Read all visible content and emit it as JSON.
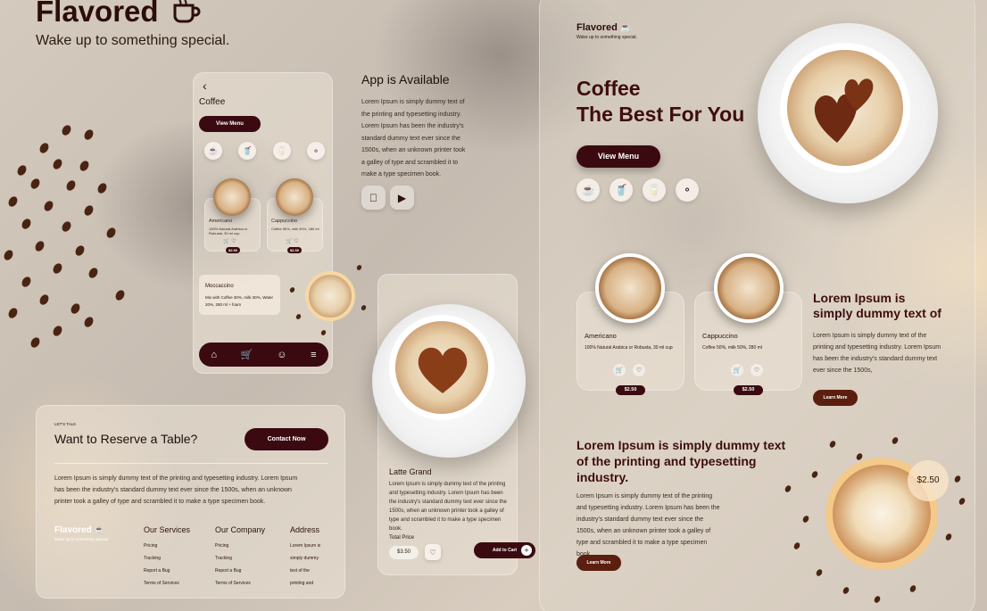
{
  "brand": {
    "name": "Flavored",
    "tagline": "Wake up to something special.",
    "icon": "coffee-cup-icon"
  },
  "phone": {
    "back": "‹",
    "title": "Coffee",
    "view_menu": "View Menu",
    "products": [
      {
        "name": "Americano",
        "desc": "100% Natural Arabica or Robusta, 30 ml cup",
        "price": "$2.50"
      },
      {
        "name": "Cappuccino",
        "desc": "Coffee 50%, milk 50%, 280 ml",
        "price": "$2.50"
      }
    ],
    "moccaccino": {
      "name": "Moccaccino",
      "desc": "Mix with Coffee 30%, milk 30%, Water 20%, 280 ml + foam"
    }
  },
  "app": {
    "title": "App is Available",
    "body": "Lorem Ipsum is simply dummy text of the printing and typesetting industry. Lorem Ipsum has been the industry's standard dummy text ever since the 1500s, when an unknown printer took a galley of type and scrambled it to make a type specimen book."
  },
  "latte": {
    "name": "Latte Grand",
    "body": "Lorem Ipsum is simply dummy text of the printing and typesetting industry. Lorem Ipsum has been the industry's standard dummy text ever since the 1500s, when an unknown printer took a galley of type and scrambled it to make a type specimen book.",
    "price_label": "Total Price",
    "price": "$3.50",
    "add_to_cart": "Add to Cart",
    "plus": "+"
  },
  "reserve": {
    "eyebrow": "LET'S TALK",
    "title": "Want to Reserve a Table?",
    "contact": "Contact Now",
    "body": "Lorem Ipsum is simply dummy text of the printing and typesetting industry. Lorem Ipsum has been the industry's standard dummy text ever since the 1500s, when an unknown printer took a galley of type and scrambled it to make a type specimen book."
  },
  "footer": {
    "brand": "Flavored",
    "tagline": "Wake up to something special.",
    "services": {
      "title": "Our Services",
      "items": [
        "Pricing",
        "Tracking",
        "Report a Bug",
        "Terms of Services"
      ]
    },
    "company": {
      "title": "Our Company",
      "items": [
        "Pricing",
        "Tracking",
        "Report a Bug",
        "Terms of Services"
      ]
    },
    "address": {
      "title": "Address",
      "lines": [
        "Lorem Ipsum is",
        "simply dummy",
        "text of the",
        "printing and"
      ]
    }
  },
  "hero": {
    "brand": "Flavored",
    "tagline": "Wake up to something special.",
    "title1": "Coffee",
    "title2": "The Best For You",
    "view_menu": "View Menu"
  },
  "desk_products": [
    {
      "name": "Americano",
      "desc": "100% Natural Arabica or Robusta, 30 ml cup",
      "price": "$2.50"
    },
    {
      "name": "Cappuccino",
      "desc": "Coffee 50%, milk 50%, 280 ml",
      "price": "$2.50"
    }
  ],
  "section2": {
    "title": "Lorem Ipsum is simply dummy text of",
    "body": "Lorem Ipsum is simply dummy text of the printing and typesetting industry. Lorem Ipsum has been the industry's standard dummy text ever since the 1500s,",
    "learn_more": "Learn More"
  },
  "section3": {
    "title": "Lorem Ipsum is simply dummy text of the printing and typesetting industry.",
    "body": "Lorem Ipsum is simply dummy text of the printing and typesetting industry. Lorem Ipsum has been the industry's standard dummy text ever since the 1500s, when an unknown printer took a galley of type and scrambled it to make a type specimen book.",
    "learn_more": "Learn More",
    "price_badge": "$2.50"
  },
  "colors": {
    "brand": "#3a0a10",
    "text": "#2a1408"
  }
}
